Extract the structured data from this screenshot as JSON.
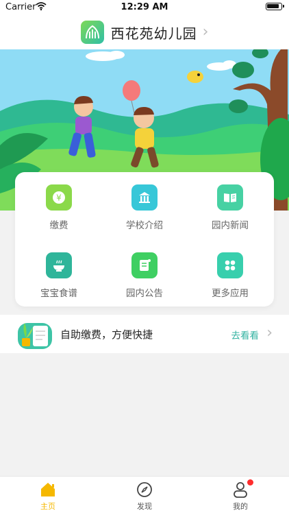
{
  "status_bar": {
    "carrier": "Carrier",
    "time": "12:29 AM"
  },
  "header": {
    "title": "西花苑幼儿园"
  },
  "grid": [
    {
      "label": "缴费",
      "icon": "yen-icon",
      "color": "#8bd94a"
    },
    {
      "label": "学校介绍",
      "icon": "school-building-icon",
      "color": "#37c7d8"
    },
    {
      "label": "园内新闻",
      "icon": "open-book-icon",
      "color": "#47d1a3"
    },
    {
      "label": "宝宝食谱",
      "icon": "rice-bowl-icon",
      "color": "#2fb59a"
    },
    {
      "label": "园内公告",
      "icon": "notice-doc-icon",
      "color": "#3fcf62"
    },
    {
      "label": "更多应用",
      "icon": "four-dots-icon",
      "color": "#38cfad"
    }
  ],
  "promo": {
    "text": "自助缴费，方便快捷",
    "action_label": "去看看"
  },
  "tabbar": {
    "items": [
      {
        "label": "主页",
        "icon": "home-icon",
        "active": true
      },
      {
        "label": "发现",
        "icon": "compass-icon",
        "active": false
      },
      {
        "label": "我的",
        "icon": "profile-icon",
        "active": false,
        "badge": true
      }
    ]
  },
  "colors": {
    "accent": "#f5b800",
    "action": "#34b3a2",
    "badge": "#ff2d2d"
  }
}
